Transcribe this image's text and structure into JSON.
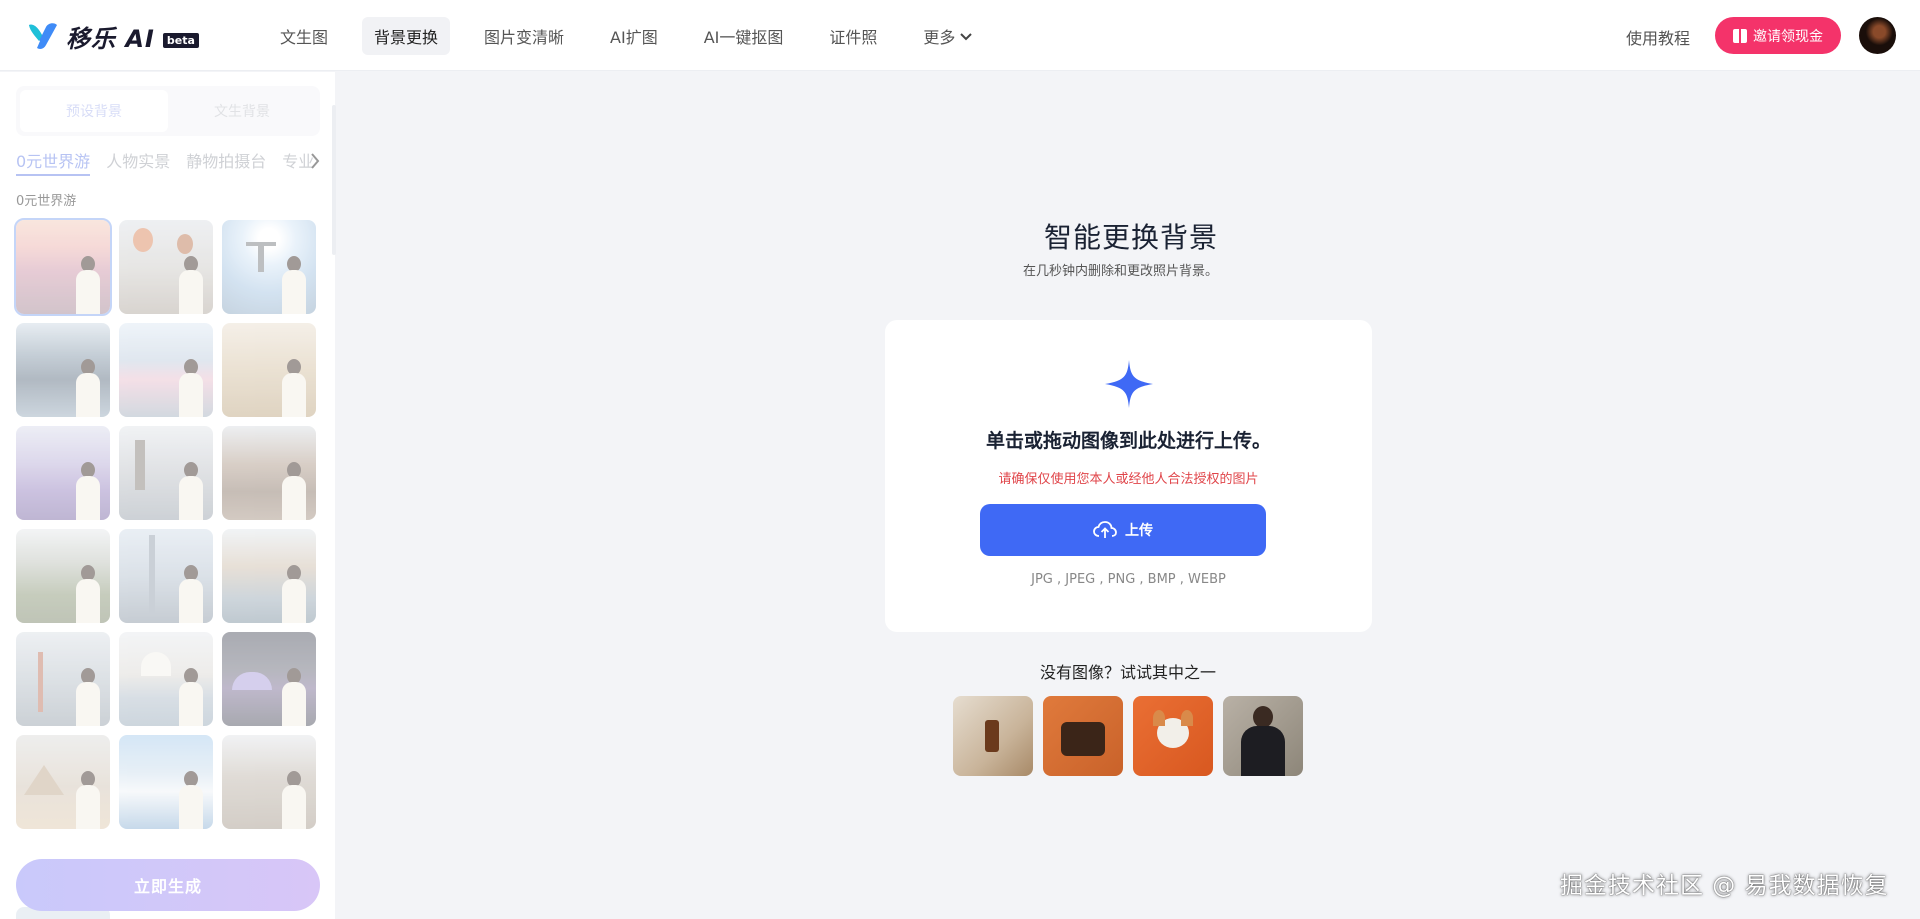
{
  "brand": {
    "name": "移乐 AI",
    "badge": "beta",
    "logo_icon": "y-logo-icon"
  },
  "nav": {
    "items": [
      {
        "label": "文生图",
        "active": false
      },
      {
        "label": "背景更换",
        "active": true
      },
      {
        "label": "图片变清晰",
        "active": false
      },
      {
        "label": "AI扩图",
        "active": false
      },
      {
        "label": "AI一键抠图",
        "active": false
      },
      {
        "label": "证件照",
        "active": false
      },
      {
        "label": "更多",
        "active": false,
        "dropdown": true
      }
    ]
  },
  "header": {
    "tutorial": "使用教程",
    "invite": "邀请领现金",
    "invite_color": "#f4336a"
  },
  "sidebar": {
    "segments": [
      {
        "label": "预设背景",
        "active": true
      },
      {
        "label": "文生背景",
        "active": false
      }
    ],
    "categories": [
      {
        "label": "0元世界游",
        "active": true
      },
      {
        "label": "人物实景"
      },
      {
        "label": "静物拍摄台"
      },
      {
        "label": "专业"
      }
    ],
    "section_label": "0元世界游",
    "thumbnails": [
      {
        "scene": "tulip-field",
        "selected": true
      },
      {
        "scene": "hot-air-balloons"
      },
      {
        "scene": "christ-the-redeemer"
      },
      {
        "scene": "fjord"
      },
      {
        "scene": "mount-fuji-blossom"
      },
      {
        "scene": "savanna"
      },
      {
        "scene": "lavender-field"
      },
      {
        "scene": "big-ben"
      },
      {
        "scene": "grand-canyon"
      },
      {
        "scene": "machu-picchu"
      },
      {
        "scene": "burj-khalifa"
      },
      {
        "scene": "venice-canal"
      },
      {
        "scene": "golden-gate"
      },
      {
        "scene": "taj-mahal"
      },
      {
        "scene": "sydney-opera-house"
      },
      {
        "scene": "pyramids"
      },
      {
        "scene": "santorini"
      },
      {
        "scene": "colosseum"
      }
    ],
    "generate_button": "立即生成"
  },
  "main": {
    "title": "智能更换背景",
    "subtitle": "在几秒钟内删除和更改照片背景。",
    "upload": {
      "heading": "单击或拖动图像到此处进行上传。",
      "warning": "请确保仅使用您本人或经他人合法授权的图片",
      "button": "上传",
      "button_icon": "cloud-upload-icon",
      "formats": "JPG , JPEG , PNG , BMP , WEBP",
      "accent": "#3f69f5"
    },
    "try_label": "没有图像？试试其中之一",
    "samples": [
      {
        "subject": "serum-bottle"
      },
      {
        "subject": "leather-handbag"
      },
      {
        "subject": "corgi-puppy"
      },
      {
        "subject": "woman-in-black"
      }
    ]
  },
  "watermark": "掘金技术社区 @ 易我数据恢复"
}
